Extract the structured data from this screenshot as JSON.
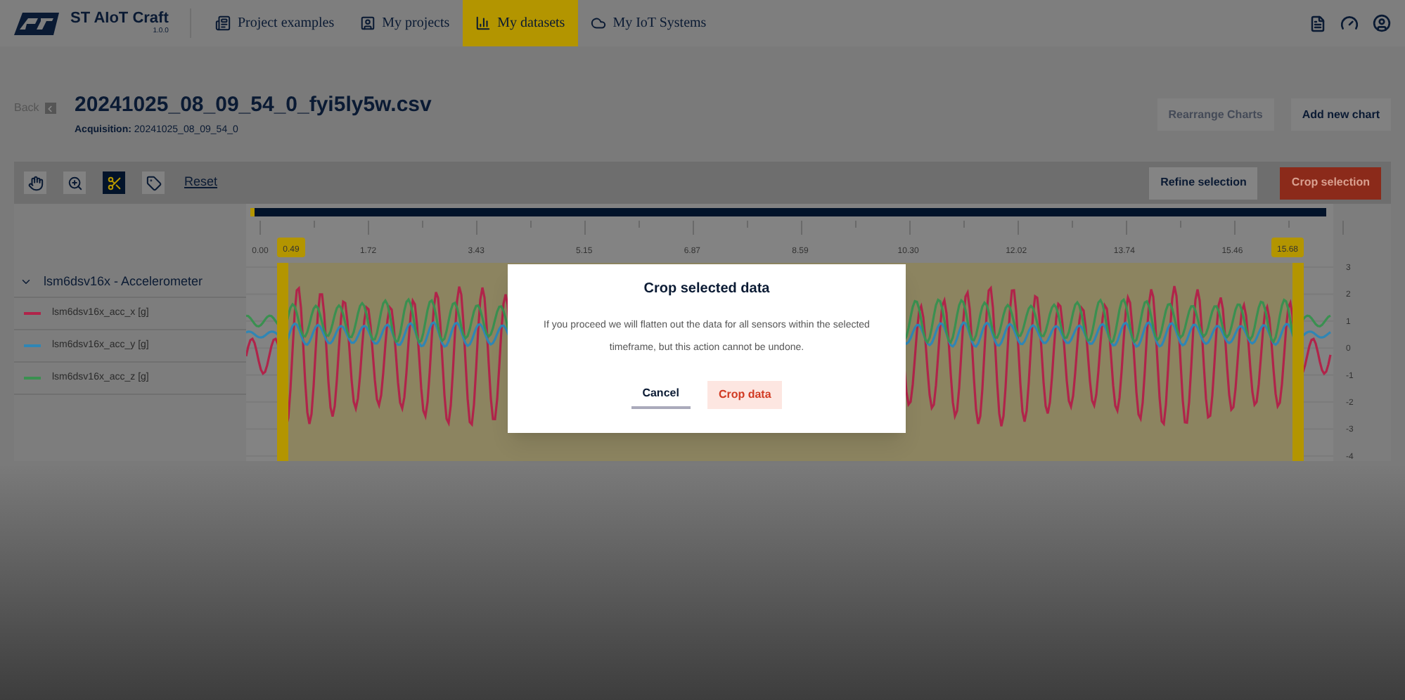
{
  "app": {
    "name": "ST AIoT Craft",
    "version": "1.0.0"
  },
  "nav": [
    {
      "label": "Project examples",
      "selected": false
    },
    {
      "label": "My projects",
      "selected": false
    },
    {
      "label": "My datasets",
      "selected": true
    },
    {
      "label": "My IoT Systems",
      "selected": false
    }
  ],
  "page": {
    "back": "Back",
    "title": "20241025_08_09_54_0_fyi5ly5w.csv",
    "acquisition_label": "Acquisition:",
    "acquisition": "20241025_08_09_54_0"
  },
  "header_buttons": [
    {
      "label": "Rearrange Charts",
      "disabled": true
    },
    {
      "label": "Add new chart",
      "disabled": false
    }
  ],
  "toolbar": {
    "tools": [
      {
        "kind": "pan",
        "selected": false
      },
      {
        "kind": "zoom",
        "selected": false
      },
      {
        "kind": "crop",
        "selected": true
      },
      {
        "kind": "tag",
        "selected": false
      }
    ],
    "reset": "Reset",
    "refine": "Refine selection",
    "crop": "Crop selection"
  },
  "chart": {
    "group": "lsm6dsv16x - Accelerometer",
    "expanded": true,
    "series": [
      {
        "name": "lsm6dsv16x_acc_x [g]",
        "color": "#b0244a"
      },
      {
        "name": "lsm6dsv16x_acc_y [g]",
        "color": "#2f86b5"
      },
      {
        "name": "lsm6dsv16x_acc_z [g]",
        "color": "#3a9050"
      }
    ],
    "xticks": [
      "0.00",
      "1.72",
      "3.43",
      "5.15",
      "6.87",
      "8.59",
      "10.30",
      "12.02",
      "13.74",
      "15.46"
    ],
    "yticks": [
      "3",
      "2",
      "1",
      "0",
      "-1",
      "-2",
      "-3",
      "-4"
    ],
    "selection": {
      "start": "0.49",
      "end": "15.68"
    }
  },
  "dialog": {
    "title": "Crop selected data",
    "message": "If you proceed we will flatten out the data for all sensors within the selected timeframe, but this action cannot be undone.",
    "cancel": "Cancel",
    "confirm": "Crop data"
  }
}
